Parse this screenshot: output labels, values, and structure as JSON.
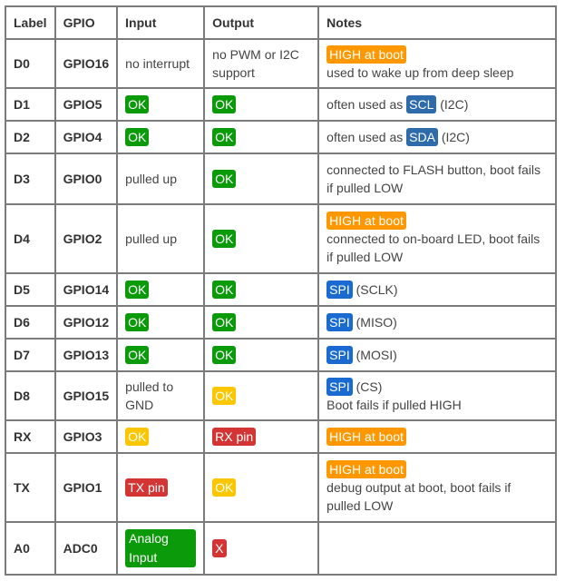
{
  "table": {
    "headers": [
      "Label",
      "GPIO",
      "Input",
      "Output",
      "Notes"
    ],
    "rows": [
      {
        "label": "D0",
        "gpio": "GPIO16",
        "input": {
          "text": "no interrupt"
        },
        "output": {
          "text": "no PWM or I2C support"
        },
        "notes": {
          "badge": "HIGH at boot",
          "text": "used to wake up from deep sleep"
        }
      },
      {
        "label": "D1",
        "gpio": "GPIO5",
        "input": {
          "badge": "OK"
        },
        "output": {
          "badge": "OK"
        },
        "notes": {
          "prefix": "often used as",
          "badge": "SCL",
          "suffix": "(I2C)"
        }
      },
      {
        "label": "D2",
        "gpio": "GPIO4",
        "input": {
          "badge": "OK"
        },
        "output": {
          "badge": "OK"
        },
        "notes": {
          "prefix": "often used as",
          "badge": "SDA",
          "suffix": "(I2C)"
        }
      },
      {
        "label": "D3",
        "gpio": "GPIO0",
        "input": {
          "text": "pulled up"
        },
        "output": {
          "badge": "OK"
        },
        "notes": {
          "text": "connected to FLASH button, boot fails if pulled LOW"
        }
      },
      {
        "label": "D4",
        "gpio": "GPIO2",
        "input": {
          "text": "pulled up"
        },
        "output": {
          "badge": "OK"
        },
        "notes": {
          "badge": "HIGH at boot",
          "text": "connected to on-board LED, boot fails if pulled LOW"
        }
      },
      {
        "label": "D5",
        "gpio": "GPIO14",
        "input": {
          "badge": "OK"
        },
        "output": {
          "badge": "OK"
        },
        "notes": {
          "badge": "SPI",
          "suffix": "(SCLK)"
        }
      },
      {
        "label": "D6",
        "gpio": "GPIO12",
        "input": {
          "badge": "OK"
        },
        "output": {
          "badge": "OK"
        },
        "notes": {
          "badge": "SPI",
          "suffix": "(MISO)"
        }
      },
      {
        "label": "D7",
        "gpio": "GPIO13",
        "input": {
          "badge": "OK"
        },
        "output": {
          "badge": "OK"
        },
        "notes": {
          "badge": "SPI",
          "suffix": "(MOSI)"
        }
      },
      {
        "label": "D8",
        "gpio": "GPIO15",
        "input": {
          "text": "pulled to GND"
        },
        "output": {
          "badge": "OK"
        },
        "notes": {
          "badge": "SPI",
          "suffix": "(CS)",
          "text": "Boot fails if pulled HIGH"
        }
      },
      {
        "label": "RX",
        "gpio": "GPIO3",
        "input": {
          "badge": "OK"
        },
        "output": {
          "badge": "RX pin"
        },
        "notes": {
          "badge": "HIGH at boot"
        }
      },
      {
        "label": "TX",
        "gpio": "GPIO1",
        "input": {
          "badge": "TX pin"
        },
        "output": {
          "badge": "OK"
        },
        "notes": {
          "badge": "HIGH at boot",
          "text": "debug output at boot, boot fails if pulled LOW"
        }
      },
      {
        "label": "A0",
        "gpio": "ADC0",
        "input": {
          "badge": "Analog Input"
        },
        "output": {
          "badge": "X"
        },
        "notes": {}
      }
    ]
  },
  "colors": {
    "ok_green": "#0a9a0a",
    "warn_yellow": "#fcc600",
    "high_orange": "#ff9800",
    "pin_red": "#d33434",
    "i2c_blue": "#2d6bab",
    "spi_blue": "#1a6bd1",
    "border": "#7b7b7b"
  }
}
